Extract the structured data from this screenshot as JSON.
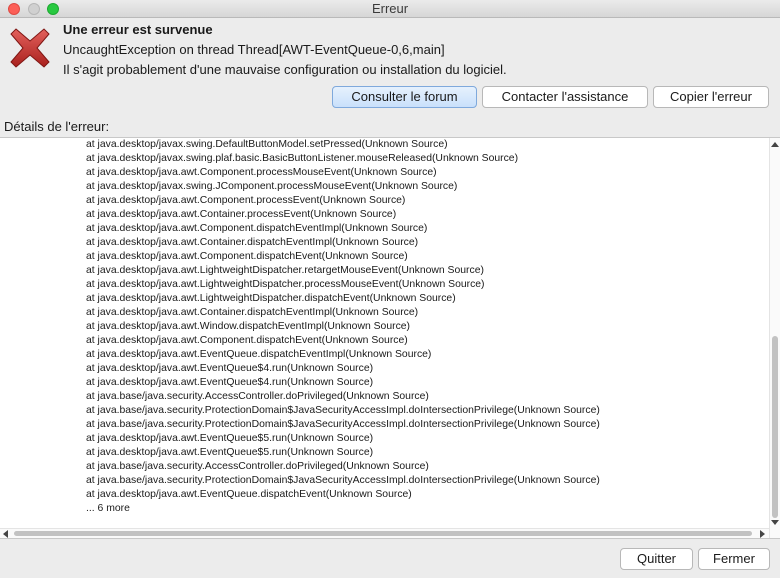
{
  "window": {
    "title": "Erreur"
  },
  "error": {
    "heading": "Une erreur est survenue",
    "exception": "UncaughtException on thread Thread[AWT-EventQueue-0,6,main]",
    "hint": "Il s'agit probablement d'une mauvaise configuration ou installation du logiciel.",
    "icon": "error-x-icon",
    "icon_color": "#c8322f"
  },
  "actions": {
    "forum_label": "Consulter le forum",
    "contact_label": "Contacter l'assistance",
    "copy_label": "Copier l'erreur"
  },
  "details": {
    "label": "Détails de l'erreur:",
    "lines": [
      "at java.desktop/javax.swing.DefaultButtonModel.setPressed(Unknown Source)",
      "at java.desktop/javax.swing.plaf.basic.BasicButtonListener.mouseReleased(Unknown Source)",
      "at java.desktop/java.awt.Component.processMouseEvent(Unknown Source)",
      "at java.desktop/javax.swing.JComponent.processMouseEvent(Unknown Source)",
      "at java.desktop/java.awt.Component.processEvent(Unknown Source)",
      "at java.desktop/java.awt.Container.processEvent(Unknown Source)",
      "at java.desktop/java.awt.Component.dispatchEventImpl(Unknown Source)",
      "at java.desktop/java.awt.Container.dispatchEventImpl(Unknown Source)",
      "at java.desktop/java.awt.Component.dispatchEvent(Unknown Source)",
      "at java.desktop/java.awt.LightweightDispatcher.retargetMouseEvent(Unknown Source)",
      "at java.desktop/java.awt.LightweightDispatcher.processMouseEvent(Unknown Source)",
      "at java.desktop/java.awt.LightweightDispatcher.dispatchEvent(Unknown Source)",
      "at java.desktop/java.awt.Container.dispatchEventImpl(Unknown Source)",
      "at java.desktop/java.awt.Window.dispatchEventImpl(Unknown Source)",
      "at java.desktop/java.awt.Component.dispatchEvent(Unknown Source)",
      "at java.desktop/java.awt.EventQueue.dispatchEventImpl(Unknown Source)",
      "at java.desktop/java.awt.EventQueue$4.run(Unknown Source)",
      "at java.desktop/java.awt.EventQueue$4.run(Unknown Source)",
      "at java.base/java.security.AccessController.doPrivileged(Unknown Source)",
      "at java.base/java.security.ProtectionDomain$JavaSecurityAccessImpl.doIntersectionPrivilege(Unknown Source)",
      "at java.base/java.security.ProtectionDomain$JavaSecurityAccessImpl.doIntersectionPrivilege(Unknown Source)",
      "at java.desktop/java.awt.EventQueue$5.run(Unknown Source)",
      "at java.desktop/java.awt.EventQueue$5.run(Unknown Source)",
      "at java.base/java.security.AccessController.doPrivileged(Unknown Source)",
      "at java.base/java.security.ProtectionDomain$JavaSecurityAccessImpl.doIntersectionPrivilege(Unknown Source)",
      "at java.desktop/java.awt.EventQueue.dispatchEvent(Unknown Source)",
      "... 6 more"
    ]
  },
  "footer": {
    "quit_label": "Quitter",
    "close_label": "Fermer"
  }
}
